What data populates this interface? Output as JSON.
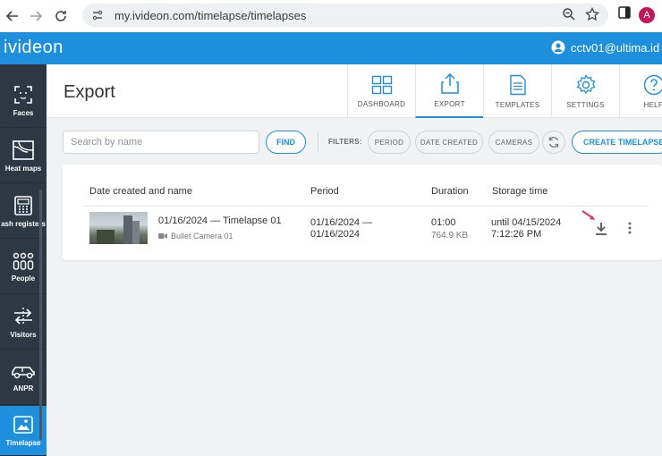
{
  "browser": {
    "url": "my.ivideon.com/timelapse/timelapses",
    "profile_initial": "A"
  },
  "app": {
    "logo": "ivideon",
    "user_email": "cctv01@ultima.id"
  },
  "sidebar": {
    "items": [
      {
        "label": "Faces",
        "icon": "face-scan-icon"
      },
      {
        "label": "Heat maps",
        "icon": "heat-map-icon"
      },
      {
        "label": "ash registers",
        "icon": "cash-register-icon"
      },
      {
        "label": "People",
        "icon": "people-icon"
      },
      {
        "label": "Visitors",
        "icon": "visitors-icon"
      },
      {
        "label": "ANPR",
        "icon": "car-icon"
      },
      {
        "label": "Timelapse",
        "icon": "timelapse-icon"
      }
    ]
  },
  "header": {
    "title": "Export",
    "tabs": [
      {
        "label": "DASHBOARD",
        "icon": "dashboard-icon"
      },
      {
        "label": "EXPORT",
        "icon": "export-icon"
      },
      {
        "label": "TEMPLATES",
        "icon": "templates-icon"
      },
      {
        "label": "SETTINGS",
        "icon": "gear-icon"
      },
      {
        "label": "HELP",
        "icon": "help-icon"
      }
    ]
  },
  "toolbar": {
    "search_placeholder": "Search by name",
    "find_label": "FIND",
    "filters_label": "FILTERS:",
    "filter_chips": [
      "PERIOD",
      "DATE CREATED",
      "CAMERAS"
    ],
    "create_label": "CREATE TIMELAPSE"
  },
  "table": {
    "columns": [
      "Date created and name",
      "Period",
      "Duration",
      "Storage time"
    ],
    "rows": [
      {
        "name": "01/16/2024 — Timelapse 01",
        "camera": "Bullet Camera 01",
        "period_start": "01/16/2024 —",
        "period_end": "01/16/2024",
        "duration": "01:00",
        "size": "764.9 KB",
        "storage_line1": "until 04/15/2024",
        "storage_line2": "7:12:26 PM"
      }
    ]
  },
  "colors": {
    "accent": "#1e8fdd",
    "sidebar": "#2e3845",
    "annotation_arrow": "#e8315b"
  }
}
